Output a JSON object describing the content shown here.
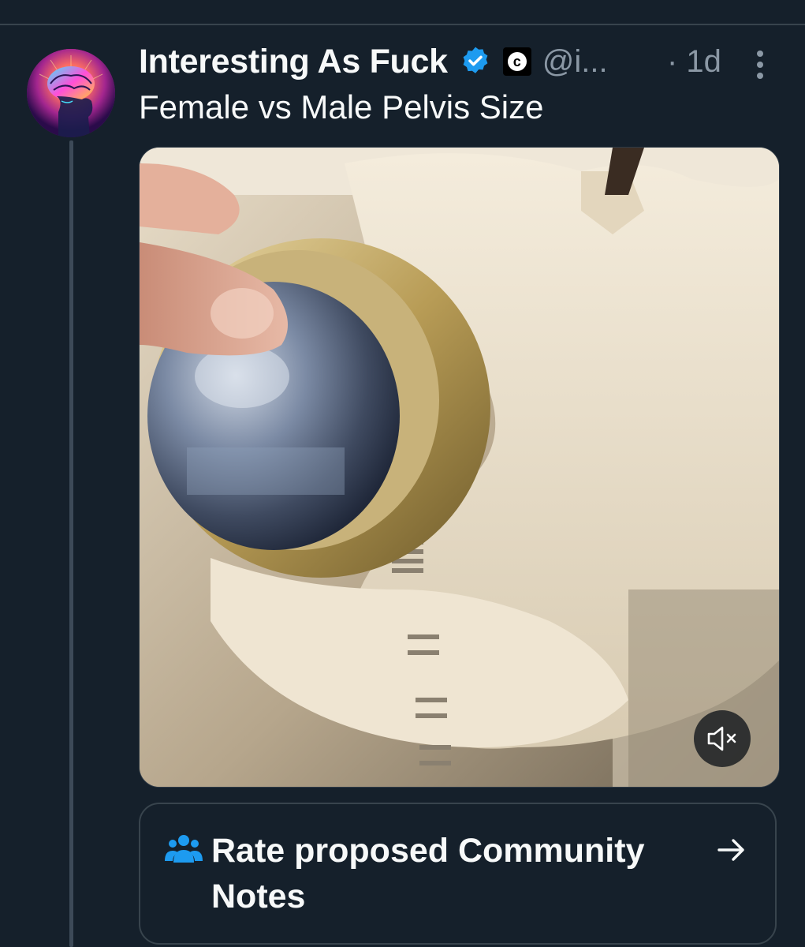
{
  "post": {
    "display_name": "Interesting As Fuck",
    "affiliate_badge": "c",
    "handle": "@i...",
    "time": "· 1d",
    "text": "Female vs Male Pelvis Size"
  },
  "icons": {
    "verified": "verified-badge-icon",
    "more": "more-options-icon",
    "mute": "volume-muted-icon",
    "community": "community-people-icon",
    "arrow": "arrow-right-icon"
  },
  "colors": {
    "background": "#15202b",
    "verified": "#1d9bf0",
    "secondary_text": "#8b98a5",
    "community_icon": "#1d9bf0"
  },
  "community_notes": {
    "label": "Rate proposed Community Notes"
  }
}
